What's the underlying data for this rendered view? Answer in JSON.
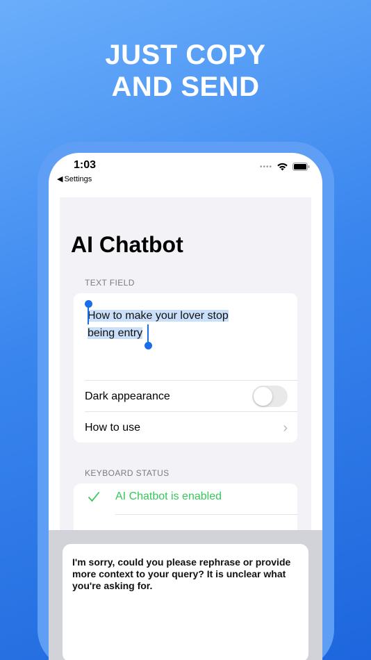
{
  "headline": {
    "line1": "JUST COPY",
    "line2": "AND SEND"
  },
  "status_bar": {
    "time": "1:03",
    "back_label": "Settings"
  },
  "page": {
    "title": "AI Chatbot"
  },
  "text_field_section": {
    "label": "TEXT FIELD",
    "line1": "How to make your lover stop",
    "line2": "being entry",
    "rows": [
      {
        "label": "Dark appearance",
        "toggle": false
      },
      {
        "label": "How to use"
      }
    ]
  },
  "keyboard_status_section": {
    "label": "KEYBOARD STATUS",
    "status_text": "AI Chatbot is enabled"
  },
  "reply": {
    "text": "I'm sorry, could you please rephrase or provide more context to your query? It is unclear what you're asking for."
  },
  "colors": {
    "accent": "#1a6ee8",
    "success": "#34c759",
    "selection": "#c9dffa"
  }
}
